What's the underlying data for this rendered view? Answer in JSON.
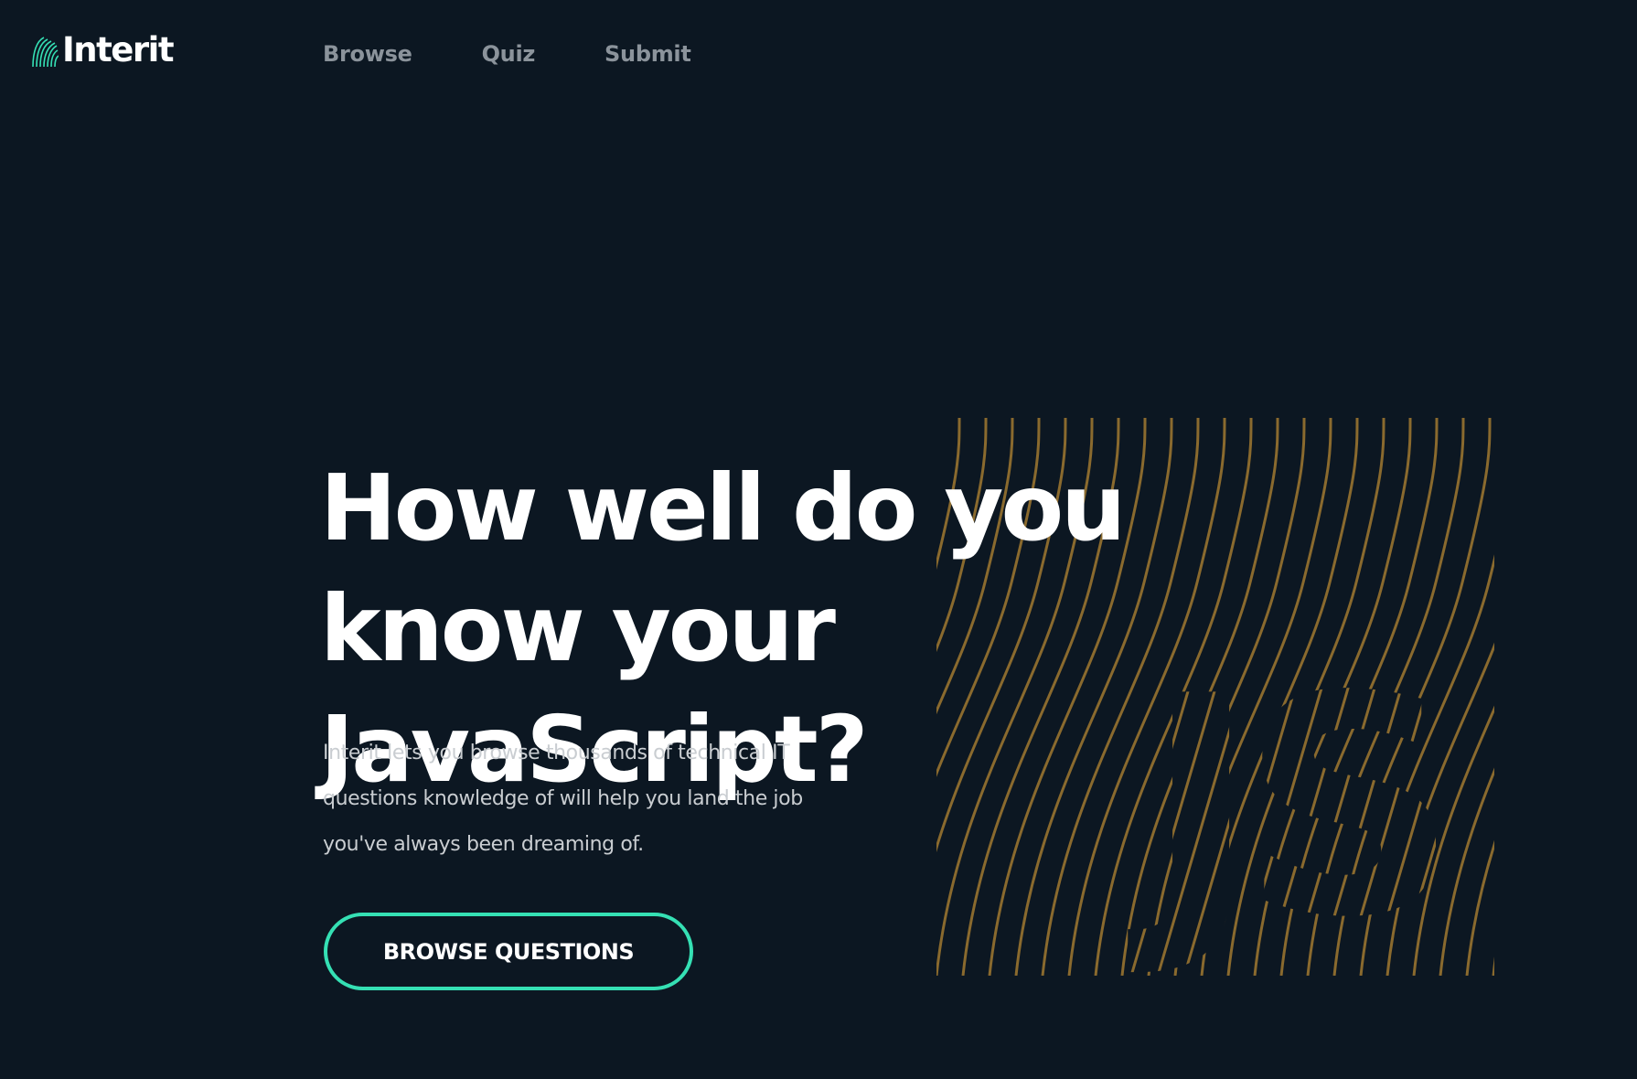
{
  "brand": {
    "name": "Interit",
    "accent_color": "#35e0b4",
    "logo_icon": "stripes-logo-icon"
  },
  "nav": {
    "items": [
      {
        "label": "Browse"
      },
      {
        "label": "Quiz"
      },
      {
        "label": "Submit"
      }
    ]
  },
  "hero": {
    "title": "How well do you know your JavaScript?",
    "description": "Interit lets you browse thousands of technical IT questions knowledge of will help you land the job you've always been dreaming of.",
    "cta_label": "BROWSE QUESTIONS",
    "art": {
      "icon": "js-wave-lines-illustration",
      "lettering": "JS",
      "line_color": "#8a6a2e"
    }
  },
  "colors": {
    "background": "#0c1722",
    "nav_text": "#8b939b",
    "body_text": "#c9cdd1"
  }
}
